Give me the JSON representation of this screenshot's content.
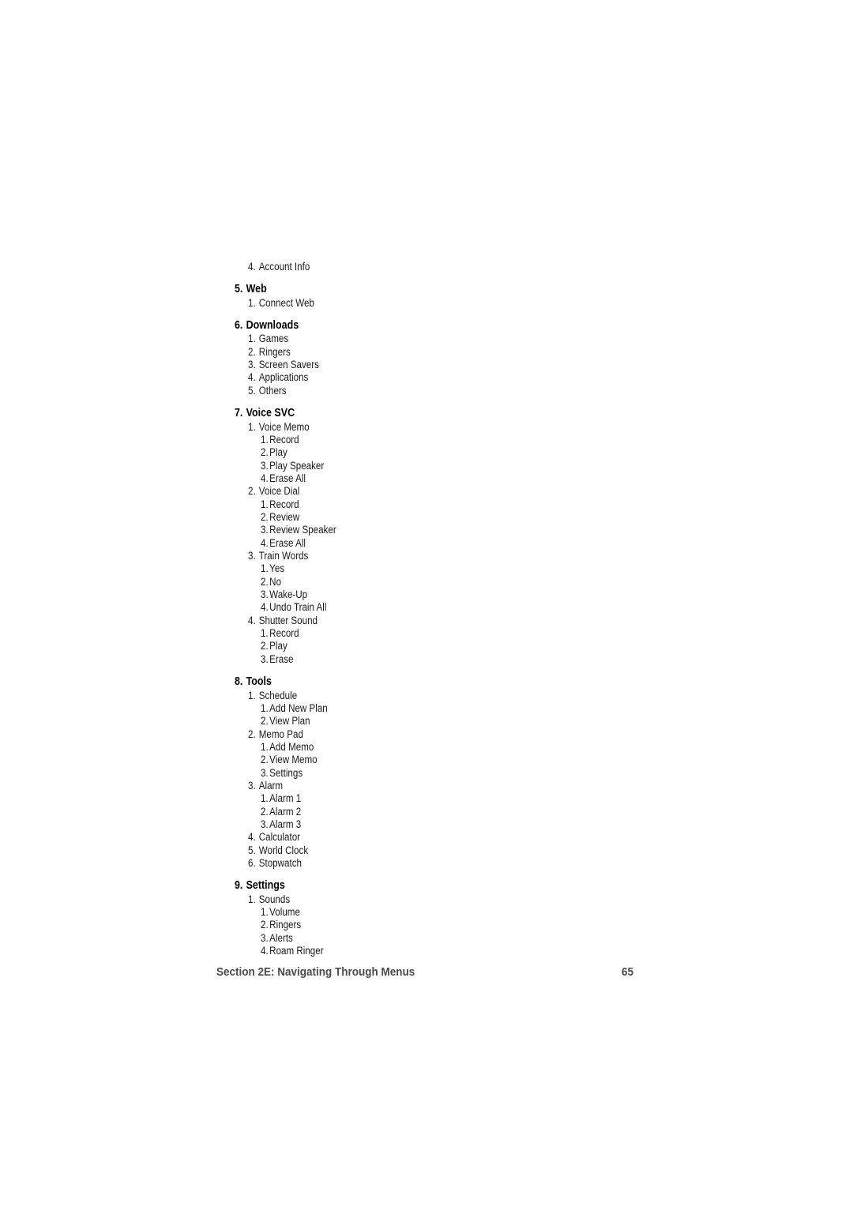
{
  "page": {
    "lines": [
      {
        "level": 1,
        "num": "4.",
        "text": "Account Info"
      },
      {
        "level": 0,
        "num": "5.",
        "text": "Web"
      },
      {
        "level": 1,
        "num": "1.",
        "text": "Connect Web"
      },
      {
        "level": 0,
        "num": "6.",
        "text": "Downloads"
      },
      {
        "level": 1,
        "num": "1.",
        "text": "Games"
      },
      {
        "level": 1,
        "num": "2.",
        "text": "Ringers"
      },
      {
        "level": 1,
        "num": "3.",
        "text": "Screen Savers"
      },
      {
        "level": 1,
        "num": "4.",
        "text": "Applications"
      },
      {
        "level": 1,
        "num": "5.",
        "text": "Others"
      },
      {
        "level": 0,
        "num": "7.",
        "text": "Voice SVC"
      },
      {
        "level": 1,
        "num": "1.",
        "text": "Voice Memo"
      },
      {
        "level": 2,
        "num": "1.",
        "text": "Record"
      },
      {
        "level": 2,
        "num": "2.",
        "text": "Play"
      },
      {
        "level": 2,
        "num": "3.",
        "text": "Play Speaker"
      },
      {
        "level": 2,
        "num": "4.",
        "text": "Erase All"
      },
      {
        "level": 1,
        "num": "2.",
        "text": "Voice Dial"
      },
      {
        "level": 2,
        "num": "1.",
        "text": "Record"
      },
      {
        "level": 2,
        "num": "2.",
        "text": "Review"
      },
      {
        "level": 2,
        "num": "3.",
        "text": "Review Speaker"
      },
      {
        "level": 2,
        "num": "4.",
        "text": "Erase All"
      },
      {
        "level": 1,
        "num": "3.",
        "text": "Train Words"
      },
      {
        "level": 2,
        "num": "1.",
        "text": "Yes"
      },
      {
        "level": 2,
        "num": "2.",
        "text": "No"
      },
      {
        "level": 2,
        "num": "3.",
        "text": "Wake-Up"
      },
      {
        "level": 2,
        "num": "4.",
        "text": "Undo Train All"
      },
      {
        "level": 1,
        "num": "4.",
        "text": "Shutter Sound"
      },
      {
        "level": 2,
        "num": "1.",
        "text": "Record"
      },
      {
        "level": 2,
        "num": "2.",
        "text": "Play"
      },
      {
        "level": 2,
        "num": "3.",
        "text": "Erase"
      },
      {
        "level": 0,
        "num": "8.",
        "text": "Tools"
      },
      {
        "level": 1,
        "num": "1.",
        "text": "Schedule"
      },
      {
        "level": 2,
        "num": "1.",
        "text": "Add New Plan"
      },
      {
        "level": 2,
        "num": "2.",
        "text": "View Plan"
      },
      {
        "level": 1,
        "num": "2.",
        "text": "Memo Pad"
      },
      {
        "level": 2,
        "num": "1.",
        "text": "Add Memo"
      },
      {
        "level": 2,
        "num": "2.",
        "text": "View Memo"
      },
      {
        "level": 2,
        "num": "3.",
        "text": "Settings"
      },
      {
        "level": 1,
        "num": "3.",
        "text": "Alarm"
      },
      {
        "level": 2,
        "num": "1.",
        "text": "Alarm 1"
      },
      {
        "level": 2,
        "num": "2.",
        "text": "Alarm 2"
      },
      {
        "level": 2,
        "num": "3.",
        "text": "Alarm 3"
      },
      {
        "level": 1,
        "num": "4.",
        "text": "Calculator"
      },
      {
        "level": 1,
        "num": "5.",
        "text": "World Clock"
      },
      {
        "level": 1,
        "num": "6.",
        "text": "Stopwatch"
      },
      {
        "level": 0,
        "num": "9.",
        "text": "Settings"
      },
      {
        "level": 1,
        "num": "1.",
        "text": "Sounds"
      },
      {
        "level": 2,
        "num": "1.",
        "text": "Volume"
      },
      {
        "level": 2,
        "num": "2.",
        "text": "Ringers"
      },
      {
        "level": 2,
        "num": "3.",
        "text": "Alerts"
      },
      {
        "level": 2,
        "num": "4.",
        "text": "Roam Ringer"
      }
    ]
  },
  "footer": {
    "section_title": "Section 2E: Navigating Through Menus",
    "page_number": "65"
  }
}
